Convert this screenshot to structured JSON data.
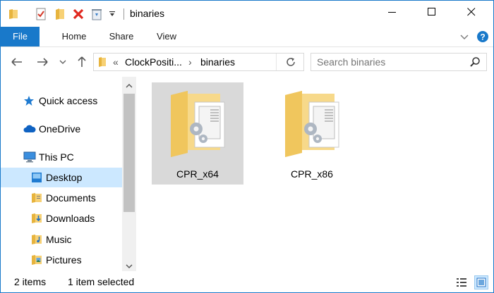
{
  "window": {
    "title": "binaries",
    "controls": {
      "minimize": "minimize-icon",
      "maximize": "maximize-icon",
      "close": "close-icon"
    }
  },
  "quick_access_toolbar": [
    "folder-icon",
    "properties-icon",
    "new-folder-icon",
    "delete-icon",
    "recycle-icon",
    "customize-dropdown-icon"
  ],
  "ribbon": {
    "tabs": [
      "File",
      "Home",
      "Share",
      "View"
    ],
    "active_tab": "File",
    "accent": "#1979ca"
  },
  "address": {
    "overflow": "«",
    "crumbs": [
      "ClockPositi...",
      "binaries"
    ],
    "separator": "›"
  },
  "search": {
    "placeholder": "Search binaries"
  },
  "nav_pane": {
    "items": [
      {
        "label": "Quick access",
        "icon": "star-icon"
      },
      {
        "label": "OneDrive",
        "icon": "cloud-icon"
      },
      {
        "label": "This PC",
        "icon": "computer-icon"
      },
      {
        "label": "Desktop",
        "icon": "desktop-folder-icon",
        "selected": true
      },
      {
        "label": "Documents",
        "icon": "documents-folder-icon"
      },
      {
        "label": "Downloads",
        "icon": "downloads-folder-icon"
      },
      {
        "label": "Music",
        "icon": "music-folder-icon"
      },
      {
        "label": "Pictures",
        "icon": "pictures-folder-icon"
      }
    ]
  },
  "files": [
    {
      "name": "CPR_x64",
      "icon": "folder-icon",
      "selected": true
    },
    {
      "name": "CPR_x86",
      "icon": "folder-icon",
      "selected": false
    }
  ],
  "status": {
    "item_count": "2 items",
    "selection": "1 item selected",
    "views": [
      "details-view-icon",
      "large-icons-view-icon"
    ]
  },
  "colors": {
    "selection": "#cce8ff",
    "tile_selected": "#d9d9d9",
    "folder": "#f7d175"
  }
}
